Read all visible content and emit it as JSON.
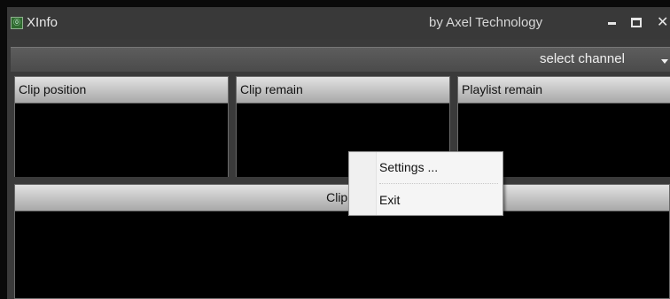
{
  "window": {
    "title": "XInfo",
    "icon_glyph": "⓪",
    "vendor": "by Axel Technology",
    "controls": {
      "minimize": "minimize",
      "maximize": "maximize",
      "close": "✕"
    }
  },
  "channel": {
    "label": "select channel",
    "icon": "chevron-down-icon"
  },
  "panels": [
    {
      "title": "Clip position"
    },
    {
      "title": "Clip remain"
    },
    {
      "title": "Playlist remain"
    }
  ],
  "clip_name_panel": {
    "title": "Clip n"
  },
  "context_menu": {
    "items": [
      {
        "label": "Settings ..."
      },
      {
        "label": "Exit"
      }
    ]
  },
  "colors": {
    "window_bg": "#3a3a3a",
    "panel_header": "#c8c8c8",
    "panel_body": "#000000",
    "menu_bg": "#f5f5f5"
  }
}
